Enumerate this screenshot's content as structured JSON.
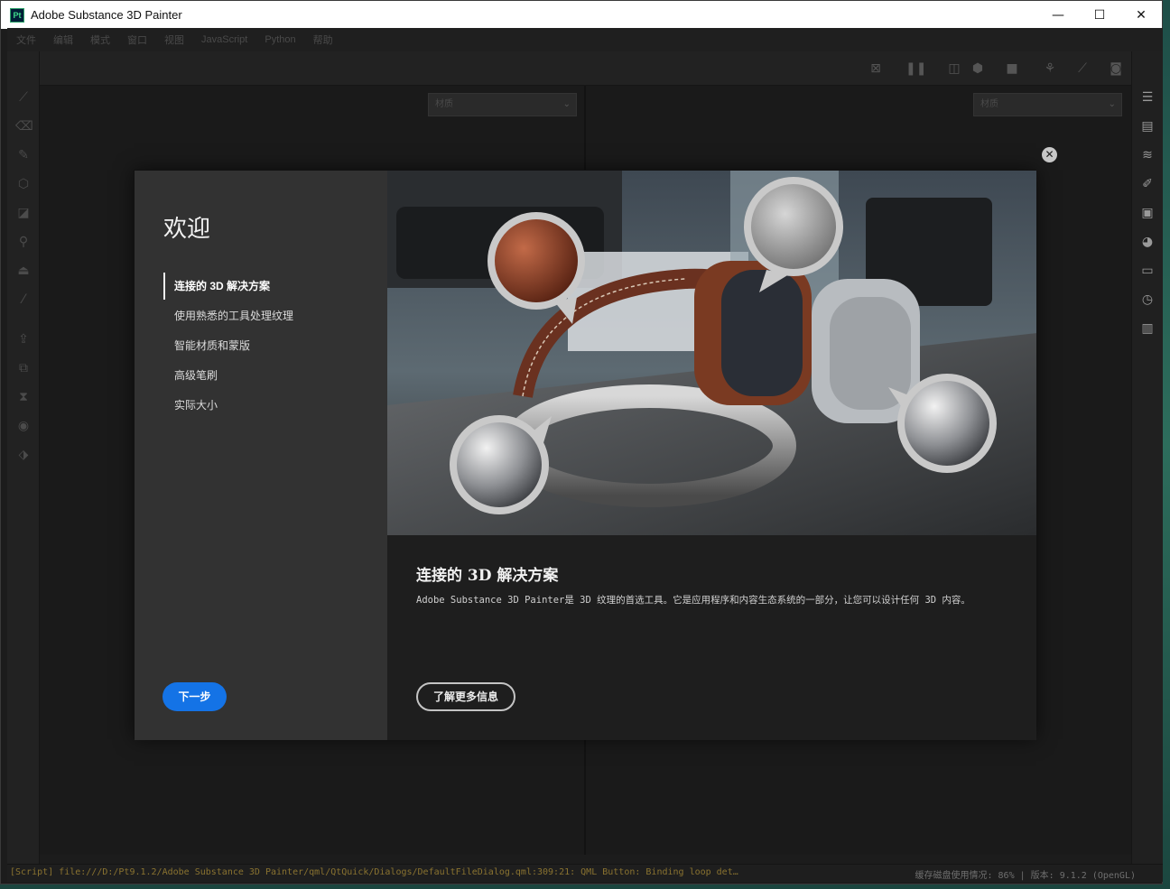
{
  "window": {
    "title": "Adobe Substance 3D Painter",
    "logo_text": "Pt"
  },
  "window_controls": {
    "minimize": "—",
    "maximize": "☐",
    "close": "✕"
  },
  "menu": [
    "文件",
    "编辑",
    "模式",
    "窗口",
    "视图",
    "JavaScript",
    "Python",
    "帮助"
  ],
  "viewport_left": {
    "select_value": "材质"
  },
  "viewport_right": {
    "select_value": "材质"
  },
  "dialog": {
    "title": "欢迎",
    "nav_items": [
      {
        "label": "连接的 3D 解决方案",
        "active": true
      },
      {
        "label": "使用熟悉的工具处理纹理",
        "active": false
      },
      {
        "label": "智能材质和蒙版",
        "active": false
      },
      {
        "label": "高级笔刷",
        "active": false
      },
      {
        "label": "实际大小",
        "active": false
      }
    ],
    "next_button": "下一步",
    "heading": "连接的 3D 解决方案",
    "description": "Adobe Substance 3D Painter是 3D 纹理的首选工具。它是应用程序和内容生态系统的一部分，让您可以设计任何 3D 内容。",
    "learn_more_button": "了解更多信息",
    "close_icon": "✕"
  },
  "status": {
    "log": "[Script] file:///D:/Pt9.1.2/Adobe Substance 3D Painter/qml/QtQuick/Dialogs/DefaultFileDialog.qml:309:21: QML Button: Binding loop det…",
    "right": "缓存磁盘使用情况:  86%  |  版本: 9.1.2 (OpenGL)"
  },
  "colors": {
    "accent": "#1473e6",
    "dialog_left_bg": "#323232",
    "app_bg": "#1c1c1c"
  }
}
